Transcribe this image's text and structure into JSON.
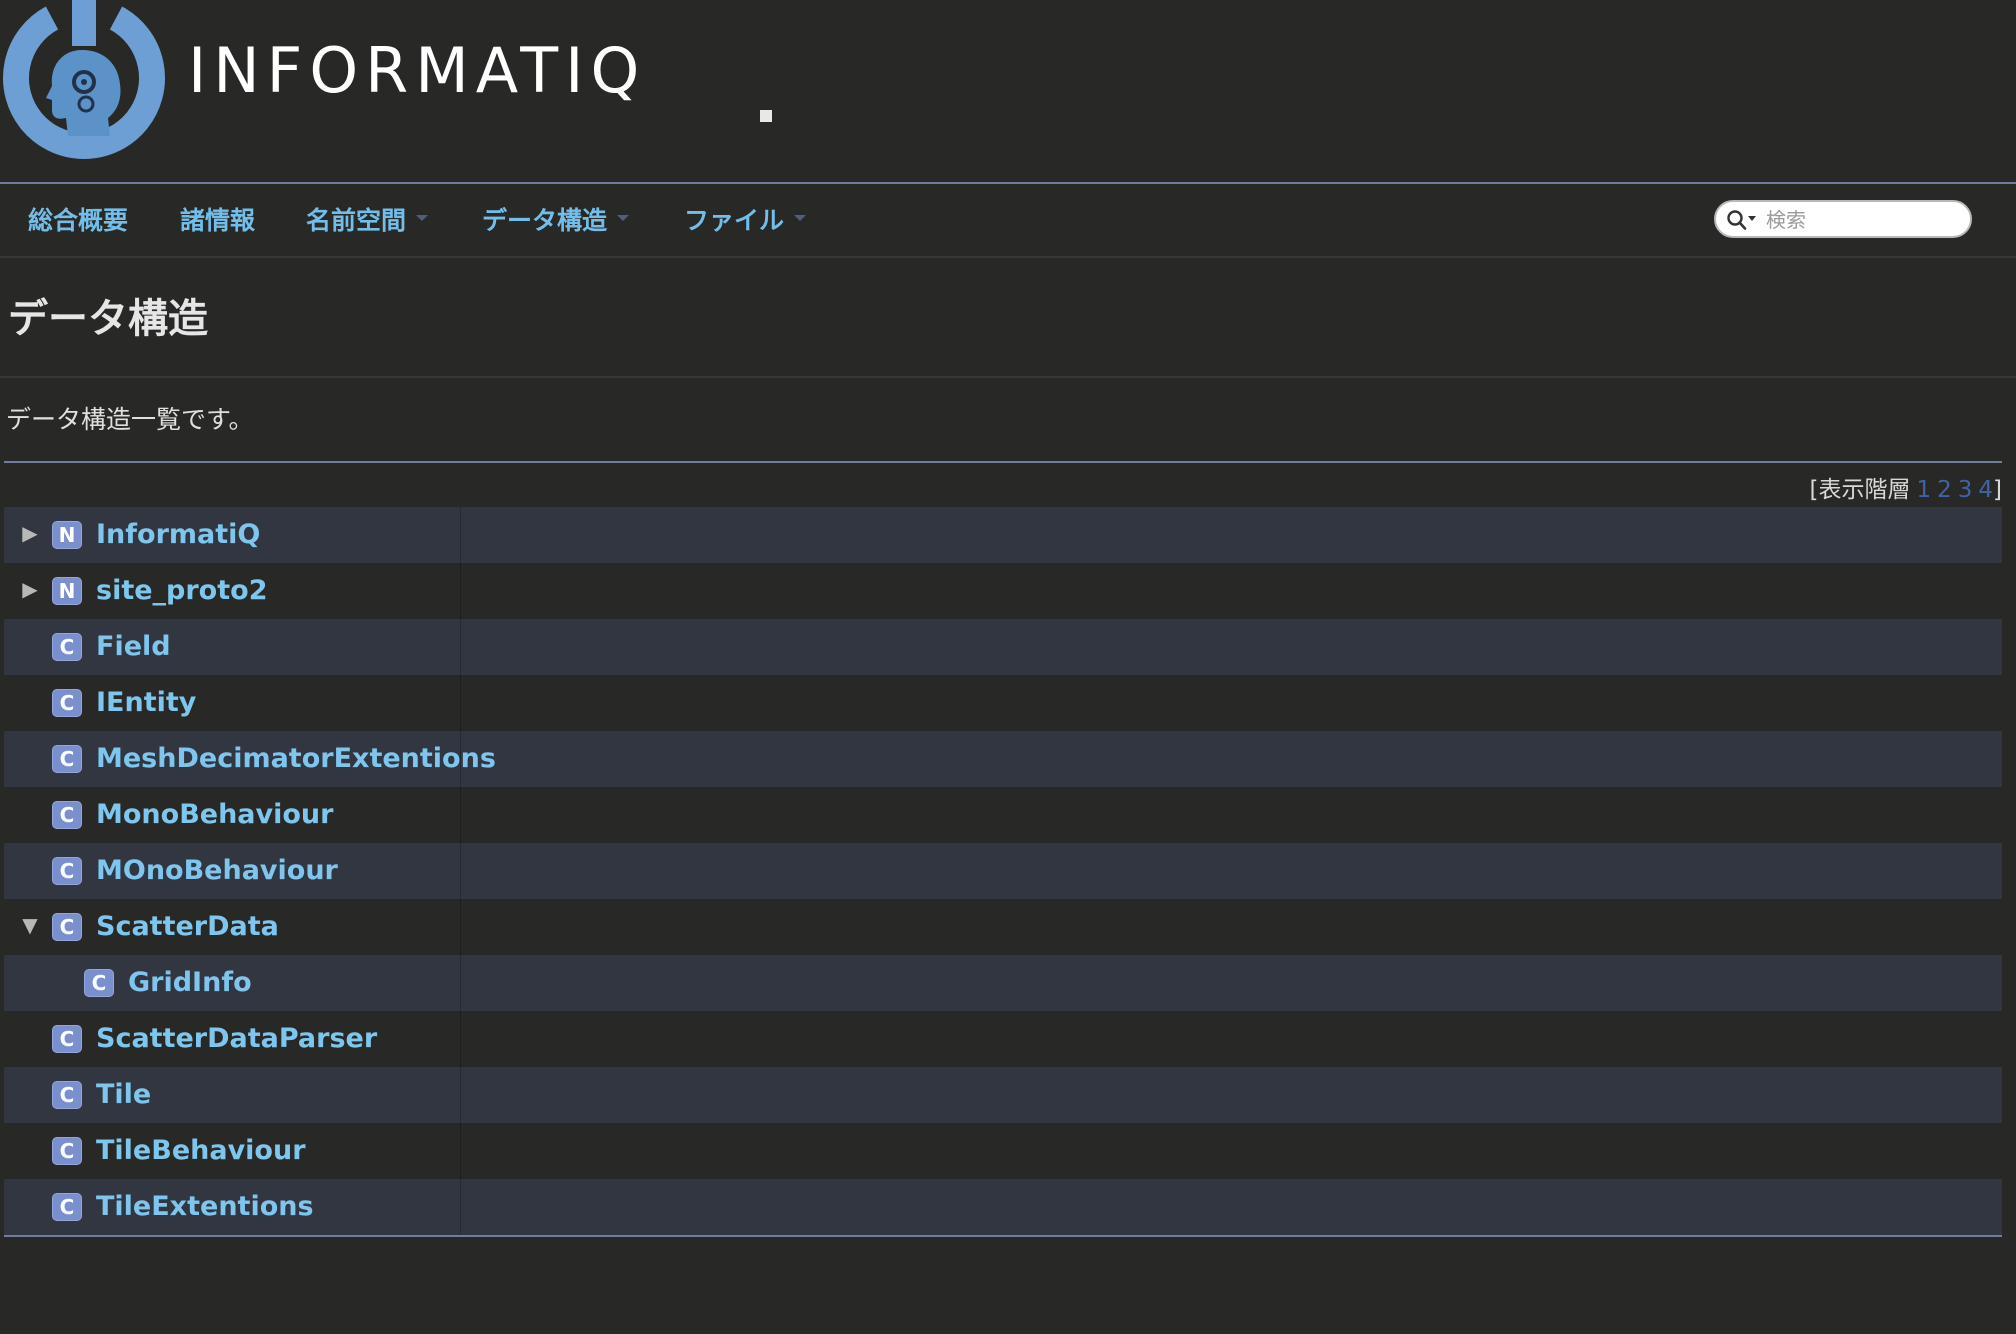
{
  "header": {
    "brand": "INFORMATIQ"
  },
  "nav": {
    "items": [
      {
        "label": "総合概要",
        "dropdown": false
      },
      {
        "label": "諸情報",
        "dropdown": false
      },
      {
        "label": "名前空間",
        "dropdown": true
      },
      {
        "label": "データ構造",
        "dropdown": true
      },
      {
        "label": "ファイル",
        "dropdown": true
      }
    ],
    "search_placeholder": "検索"
  },
  "page": {
    "title": "データ構造",
    "intro": "データ構造一覧です。",
    "levels": {
      "prefix": "[表示階層",
      "levels": [
        "1",
        "2",
        "3",
        "4"
      ],
      "suffix": "]"
    }
  },
  "tree": [
    {
      "badge": "N",
      "name": "InformatiQ",
      "arrow": "collapsed"
    },
    {
      "badge": "N",
      "name": "site_proto2",
      "arrow": "collapsed"
    },
    {
      "badge": "C",
      "name": "Field"
    },
    {
      "badge": "C",
      "name": "IEntity"
    },
    {
      "badge": "C",
      "name": "MeshDecimatorExtentions"
    },
    {
      "badge": "C",
      "name": "MonoBehaviour"
    },
    {
      "badge": "C",
      "name": "MOnoBehaviour"
    },
    {
      "badge": "C",
      "name": "ScatterData",
      "arrow": "expanded"
    },
    {
      "badge": "C",
      "name": "GridInfo"
    },
    {
      "badge": "C",
      "name": "ScatterDataParser"
    },
    {
      "badge": "C",
      "name": "Tile"
    },
    {
      "badge": "C",
      "name": "TileBehaviour"
    },
    {
      "badge": "C",
      "name": "TileExtentions"
    }
  ],
  "colors": {
    "background": "#282826",
    "row_alt": "#323641",
    "link": "#7ec6ee",
    "nav_link": "#73bde9",
    "badge": "#7a8fce",
    "logo": "#6d9ed4",
    "rule": "#6f7ea0"
  }
}
